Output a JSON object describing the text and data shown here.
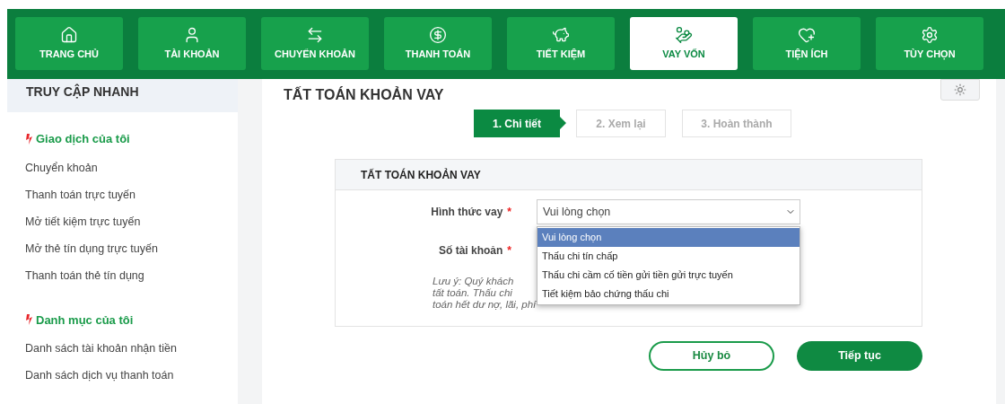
{
  "nav": [
    {
      "label": "TRANG CHỦ",
      "selected": false
    },
    {
      "label": "TÀI KHOẢN",
      "selected": false
    },
    {
      "label": "CHUYỂN KHOẢN",
      "selected": false
    },
    {
      "label": "THANH TOÁN",
      "selected": false
    },
    {
      "label": "TIẾT KIỆM",
      "selected": false
    },
    {
      "label": "VAY VỐN",
      "selected": true
    },
    {
      "label": "TIỆN ÍCH",
      "selected": false
    },
    {
      "label": "TÙY CHỌN",
      "selected": false
    }
  ],
  "sidebar": {
    "title": "TRUY CẬP NHANH",
    "sections": [
      {
        "heading": "Giao dịch của tôi",
        "items": [
          "Chuyển khoản",
          "Thanh toán trực tuyến",
          "Mở tiết kiệm trực tuyến",
          "Mở thẻ tín dụng trực tuyến",
          "Thanh toán thẻ tín dụng"
        ]
      },
      {
        "heading": "Danh mục của tôi",
        "items": [
          "Danh sách tài khoản nhận tiền",
          "Danh sách dịch vụ thanh toán"
        ]
      }
    ]
  },
  "page_title": "TẤT TOÁN KHOẢN VAY",
  "steps": [
    {
      "label": "1. Chi tiết",
      "selected": true
    },
    {
      "label": "2. Xem lại",
      "selected": false
    },
    {
      "label": "3. Hoàn thành",
      "selected": false
    }
  ],
  "form": {
    "title": "TẤT TOÁN KHOẢN VAY",
    "loan_type": {
      "label": "Hình thức vay",
      "required_mark": "*",
      "value": "Vui lòng chọn",
      "options": [
        {
          "label": "Vui lòng chọn",
          "selected": true
        },
        {
          "label": "Thấu chi tín chấp",
          "selected": false
        },
        {
          "label": "Thấu chi cầm cố tiền gửi tiền gửi trực tuyến",
          "selected": false
        },
        {
          "label": "Tiết kiệm bảo chứng thấu chi",
          "selected": false
        }
      ]
    },
    "account": {
      "label": "Số tài khoản",
      "required_mark": "*"
    },
    "note_lines": [
      "Lưu ý: Quý khách",
      "tất toán. Thấu chi",
      "toán hết dư nợ, lãi, phí"
    ]
  },
  "buttons": {
    "cancel": "Hủy bỏ",
    "continue": "Tiếp tục"
  }
}
